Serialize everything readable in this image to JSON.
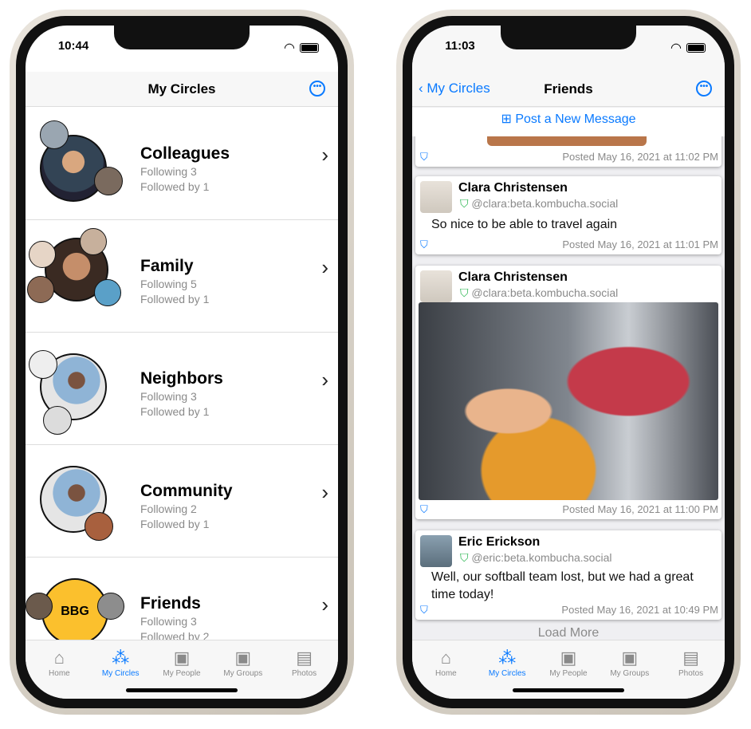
{
  "left": {
    "time": "10:44",
    "title": "My Circles",
    "circles": [
      {
        "name": "Colleagues",
        "following": "Following 3",
        "followed": "Followed by 1"
      },
      {
        "name": "Family",
        "following": "Following 5",
        "followed": "Followed by 1"
      },
      {
        "name": "Neighbors",
        "following": "Following 3",
        "followed": "Followed by 1"
      },
      {
        "name": "Community",
        "following": "Following 2",
        "followed": "Followed by 1"
      },
      {
        "name": "Friends",
        "following": "Following 3",
        "followed": "Followed by 2",
        "badge": "BBG"
      }
    ]
  },
  "right": {
    "time": "11:03",
    "back": "My Circles",
    "title": "Friends",
    "post_new": "Post a New Message",
    "posts": [
      {
        "posted": "Posted May 16, 2021 at 11:02 PM"
      },
      {
        "author": "Clara Christensen",
        "handle": "@clara:beta.kombucha.social",
        "body": "So nice to be able to travel again",
        "posted": "Posted May 16, 2021 at 11:01 PM"
      },
      {
        "author": "Clara Christensen",
        "handle": "@clara:beta.kombucha.social",
        "posted": "Posted May 16, 2021 at 11:00 PM"
      },
      {
        "author": "Eric Erickson",
        "handle": "@eric:beta.kombucha.social",
        "body": "Well, our softball team lost, but we had a great time today!",
        "posted": "Posted May 16, 2021 at 10:49 PM"
      }
    ],
    "load_more": "Load More"
  },
  "tabs": [
    {
      "label": "Home",
      "icon": "house-icon"
    },
    {
      "label": "My Circles",
      "icon": "circles-icon"
    },
    {
      "label": "My People",
      "icon": "person-card-icon"
    },
    {
      "label": "My Groups",
      "icon": "group-card-icon"
    },
    {
      "label": "Photos",
      "icon": "photos-icon"
    }
  ],
  "colors": {
    "accent": "#0a7aff",
    "verified": "#22b34a",
    "badge": "#fbc02d"
  }
}
